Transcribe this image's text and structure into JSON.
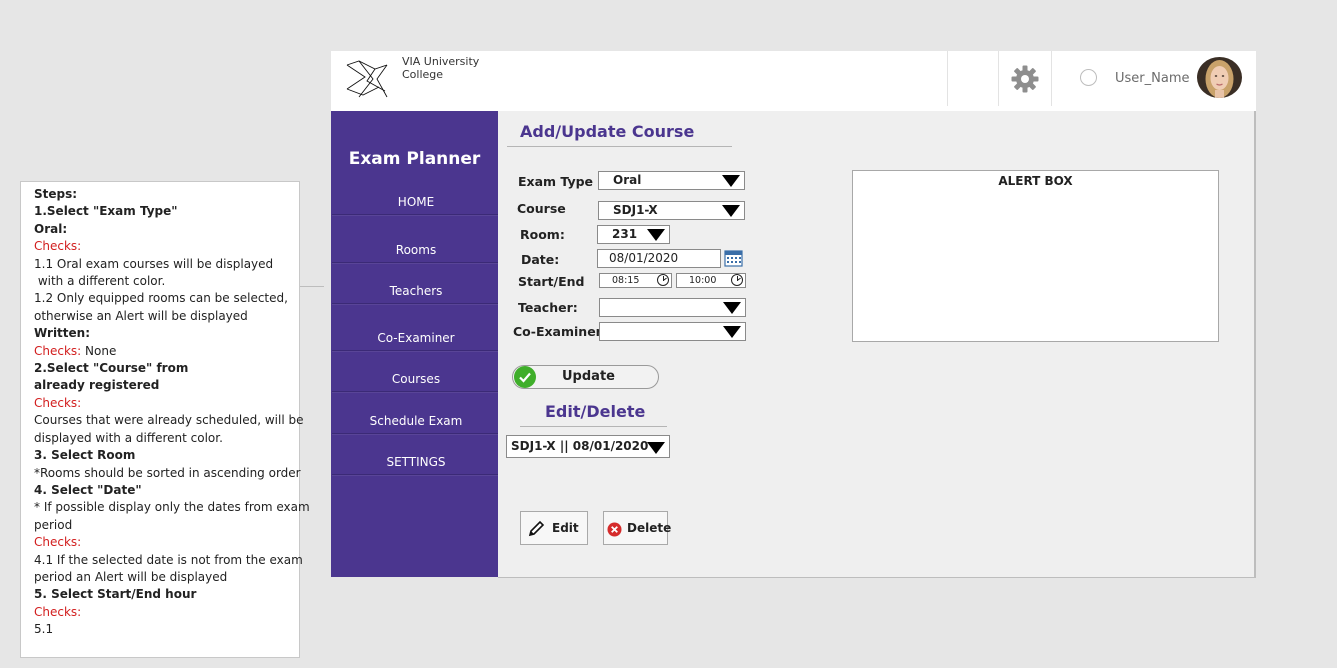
{
  "notes": {
    "lines": [
      {
        "text": "Steps:",
        "style": "b"
      },
      {
        "text": "1.Select \"Exam Type\"",
        "style": "b"
      },
      {
        "text": "Oral:",
        "style": "b"
      },
      {
        "text": "Checks:",
        "style": "red"
      },
      {
        "text": "1.1 Oral exam courses will be displayed",
        "style": ""
      },
      {
        "text": " with a different color.",
        "style": ""
      },
      {
        "text": "1.2 Only equipped rooms can be selected,",
        "style": ""
      },
      {
        "text": "otherwise an Alert will be displayed",
        "style": ""
      },
      {
        "text": "Written:",
        "style": "b"
      },
      {
        "text": "",
        "style": "mixed"
      },
      {
        "text": "2.Select \"Course\" from",
        "style": "b"
      },
      {
        "text": "already registered",
        "style": "b"
      },
      {
        "text": "Checks:",
        "style": "red"
      },
      {
        "text": "Courses that were already scheduled, will be",
        "style": ""
      },
      {
        "text": "displayed with a different color.",
        "style": ""
      },
      {
        "text": "3. Select Room",
        "style": "b"
      },
      {
        "text": "*Rooms should be sorted in ascending order",
        "style": ""
      },
      {
        "text": "4. Select \"Date\"",
        "style": "b"
      },
      {
        "text": "* If possible display only the dates from exam",
        "style": ""
      },
      {
        "text": "period",
        "style": ""
      },
      {
        "text": "Checks:",
        "style": "red"
      },
      {
        "text": "4.1 If the selected date is not from the exam",
        "style": ""
      },
      {
        "text": "period an Alert will be displayed",
        "style": ""
      },
      {
        "text": "5. Select Start/End hour",
        "style": "b"
      },
      {
        "text": "Checks:",
        "style": "red"
      },
      {
        "text": "5.1",
        "style": ""
      }
    ],
    "written_checks_label": "Checks:",
    "written_checks_value": " None"
  },
  "header": {
    "logo_line1": "VIA University",
    "logo_line2": "College",
    "user_name": "User_Name",
    "icons": [
      "via-logo-icon",
      "gear-icon",
      "radio-circle",
      "avatar"
    ]
  },
  "sidebar": {
    "title": "Exam Planner",
    "items": [
      {
        "label": "HOME",
        "name": "sidebar-item-home"
      },
      {
        "label": "Rooms",
        "name": "sidebar-item-rooms"
      },
      {
        "label": "Teachers",
        "name": "sidebar-item-teachers"
      },
      {
        "label": "Co-Examiner",
        "name": "sidebar-item-co-examiner"
      },
      {
        "label": "Courses",
        "name": "sidebar-item-courses"
      },
      {
        "label": "Schedule Exam",
        "name": "sidebar-item-schedule-exam"
      },
      {
        "label": "SETTINGS",
        "name": "sidebar-item-settings"
      }
    ]
  },
  "form": {
    "heading": "Add/Update Course",
    "exam_type_label": "Exam Type",
    "exam_type_value": "Oral",
    "course_label": "Course",
    "course_value": "SDJ1-X",
    "room_label": "Room:",
    "room_value": "231",
    "date_label": "Date:",
    "date_value": "08/01/2020",
    "start_end_label": "Start/End",
    "start_value": "08:15",
    "end_value": "10:00",
    "teacher_label": "Teacher:",
    "teacher_value": "",
    "co_examiner_label": "Co-Examiner",
    "co_examiner_value": "",
    "update_label": "Update"
  },
  "alert": {
    "title": "ALERT BOX"
  },
  "edit_delete": {
    "heading": "Edit/Delete",
    "selected_value": "SDJ1-X || 08/01/2020",
    "edit_label": "Edit",
    "delete_label": "Delete"
  },
  "colors": {
    "sidebar": "#4b368f",
    "heading": "#4b368f",
    "check_green": "#3fae2a",
    "delete_red": "#d52b2b",
    "checks_red": "#d21e1e"
  }
}
